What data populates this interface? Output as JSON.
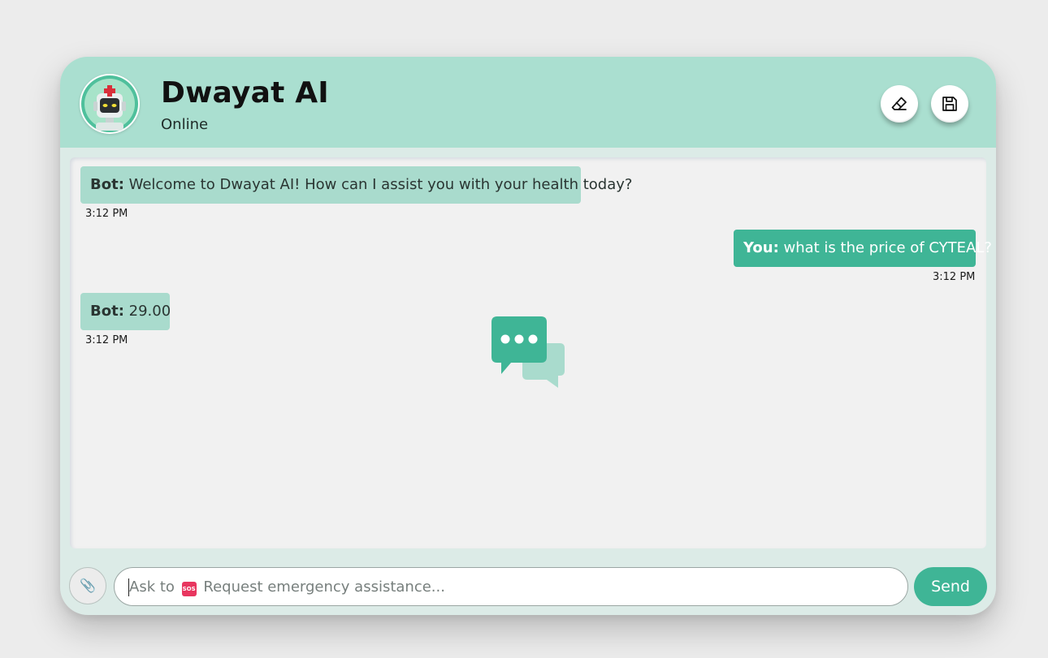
{
  "header": {
    "title": "Dwayat AI",
    "status": "Online",
    "avatar_icon": "robot-doctor-icon",
    "erase_icon": "eraser-icon",
    "save_icon": "floppy-disk-icon"
  },
  "messages": [
    {
      "sender_label": "Bot:",
      "text": " Welcome to Dwayat AI! How can I assist you with your health today?",
      "time": "3:12 PM",
      "role": "bot"
    },
    {
      "sender_label": "You:",
      "text": " what is the price of CYTEAL?",
      "time": "3:12 PM",
      "role": "user"
    },
    {
      "sender_label": "Bot:",
      "text": " 29.00",
      "time": "3:12 PM",
      "role": "bot"
    }
  ],
  "center_icon": "chat-bubbles-icon",
  "input": {
    "attach_icon": "paperclip-icon",
    "placeholder_prefix": "Ask to",
    "sos_badge": "SOS",
    "placeholder_suffix": "Request emergency assistance...",
    "send_label": "Send"
  },
  "colors": {
    "header_bg": "#aadfd0",
    "accent": "#3fb596",
    "bot_bubble": "#a9dbcd",
    "sos_red": "#e8365f"
  }
}
